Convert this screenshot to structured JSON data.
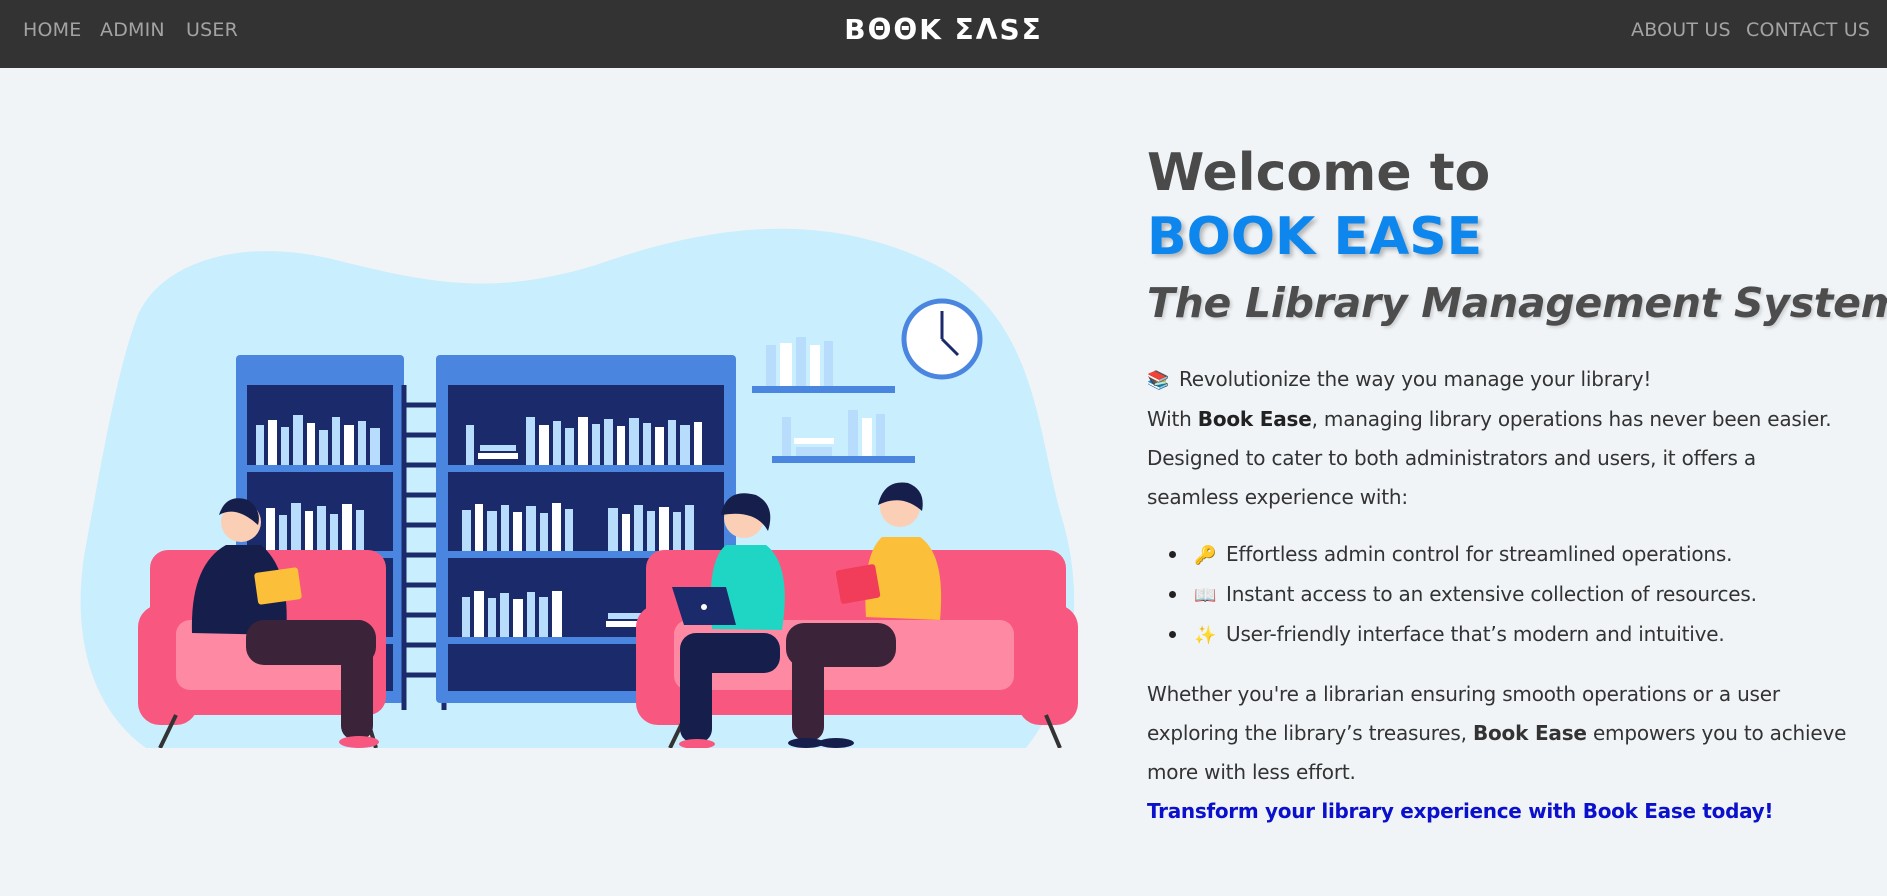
{
  "nav": {
    "left_links": [
      "HOME",
      "ADMIN",
      "USER"
    ],
    "brand": "BΘΘK ΣΛSΣ",
    "right_links": [
      "ABOUT US",
      "CONTACT US"
    ]
  },
  "hero": {
    "welcome": "Welcome to",
    "app_name": "BOOK EASE",
    "tagline": "The Library Management System",
    "intro_emoji": "📚",
    "intro_line1": "Revolutionize the way you manage your library!",
    "intro_line2_pre": "With ",
    "intro_line2_bold": "Book Ease",
    "intro_line2_post": ", managing library operations has never been easier.",
    "intro_line3": "Designed to cater to both administrators and users, it offers a",
    "intro_line4": "seamless experience with:",
    "features": [
      {
        "emoji": "🔑",
        "icon": "key-icon",
        "text": "Effortless admin control for streamlined operations."
      },
      {
        "emoji": "📖",
        "icon": "open-book-icon",
        "text": "Instant access to an extensive collection of resources."
      },
      {
        "emoji": "✨",
        "icon": "sparkles-icon",
        "text": "User-friendly interface that’s modern and intuitive."
      }
    ],
    "closing_line1": "Whether you're a librarian ensuring smooth operations or a user",
    "closing_line2_pre": "exploring the library’s treasures, ",
    "closing_line2_bold": "Book Ease",
    "closing_line2_post": " empowers you to achieve",
    "closing_line3": "more with less effort.",
    "cta": "Transform your library experience with Book Ease today!"
  },
  "colors": {
    "navbar": "#333333",
    "nav_link": "#a3a3a3",
    "accent_blue": "#0d86ee",
    "cta_blue": "#0a10cc",
    "page_bg": "#f0f4f7"
  }
}
